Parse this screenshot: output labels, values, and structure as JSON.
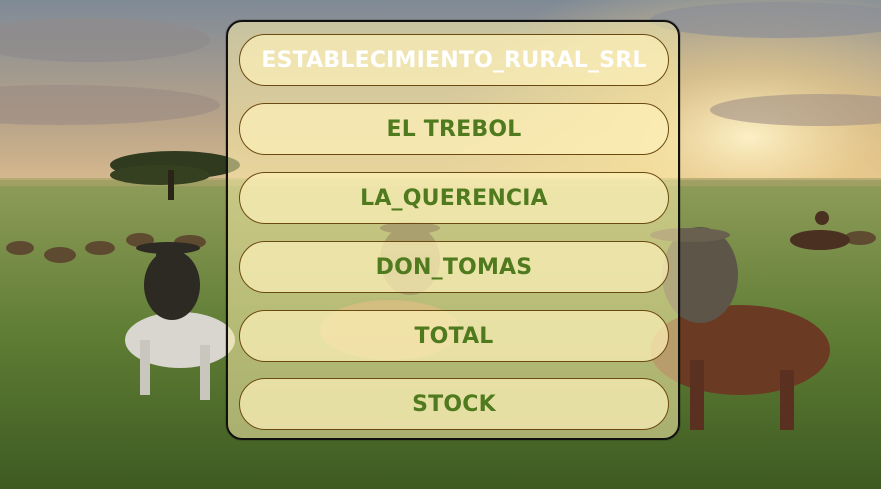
{
  "menu": {
    "items": [
      {
        "label": "ESTABLECIMIENTO_RURAL_SRL"
      },
      {
        "label": "EL TREBOL"
      },
      {
        "label": "LA_QUERENCIA"
      },
      {
        "label": "DON_TOMAS"
      },
      {
        "label": "TOTAL"
      },
      {
        "label": "STOCK"
      }
    ]
  },
  "colors": {
    "primary_text": "#ffffff",
    "item_text": "#4f7a1e",
    "panel_border": "#111111",
    "button_border": "#6b4a12"
  },
  "background": {
    "scene": "gauchos-on-horseback-herding-cattle-at-sunset"
  }
}
